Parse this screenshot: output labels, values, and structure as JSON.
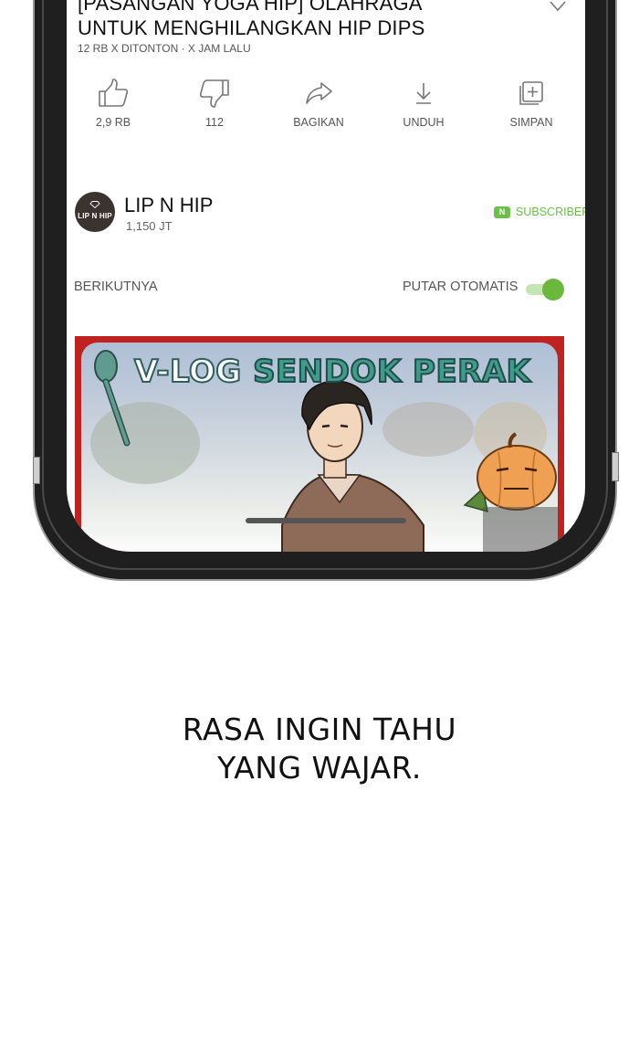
{
  "video": {
    "title_line1": "[PASANGAN YOGA HIP] OLAHRAGA",
    "title_line2": "UNTUK MENGHILANGKAN HIP DIPS",
    "meta": "12 RB X DITONTON · X JAM LALU"
  },
  "actions": [
    {
      "icon": "thumbs-up-icon",
      "label": "2,9 RB"
    },
    {
      "icon": "thumbs-down-icon",
      "label": "112"
    },
    {
      "icon": "share-icon",
      "label": "BAGIKAN"
    },
    {
      "icon": "download-icon",
      "label": "UNDUH"
    },
    {
      "icon": "save-icon",
      "label": "SIMPAN"
    }
  ],
  "channel": {
    "avatar_text": "LIP N HIP",
    "name": "LIP N HIP",
    "subscribers": "1,150 JT",
    "subscribe_badge": "N",
    "subscribe_label": "SUBSCRIBER"
  },
  "next": {
    "label": "BERIKUTNYA",
    "autoplay_label": "PUTAR OTOMATIS",
    "autoplay_on": true
  },
  "thumbnail": {
    "title_part1": "V-LOG",
    "title_part2": "SENDOK PERAK"
  },
  "caption": {
    "line1": "RASA INGIN TAHU",
    "line2": "YANG WAJAR."
  },
  "colors": {
    "accent_green": "#6cc04a",
    "thumb_border": "#c0221f",
    "phone_frame": "#1f1f1f"
  }
}
